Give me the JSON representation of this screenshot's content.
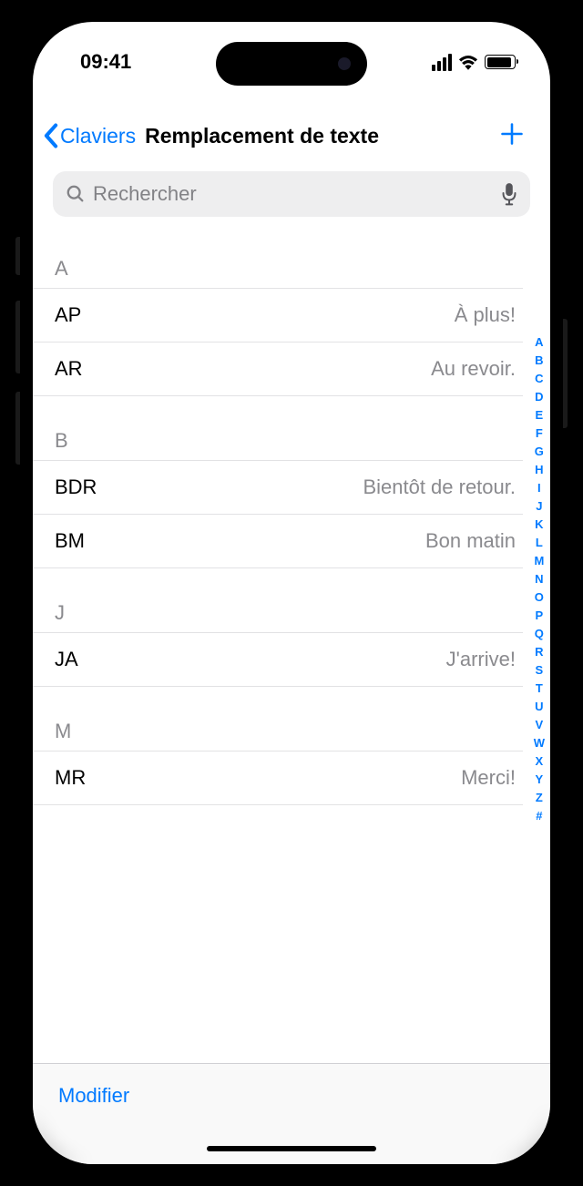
{
  "status": {
    "time": "09:41"
  },
  "nav": {
    "back": "Claviers",
    "title": "Remplacement de texte"
  },
  "search": {
    "placeholder": "Rechercher"
  },
  "sections": [
    {
      "letter": "A",
      "rows": [
        {
          "short": "AP",
          "phrase": "À plus!"
        },
        {
          "short": "AR",
          "phrase": "Au revoir."
        }
      ]
    },
    {
      "letter": "B",
      "rows": [
        {
          "short": "BDR",
          "phrase": "Bientôt de retour."
        },
        {
          "short": "BM",
          "phrase": "Bon matin"
        }
      ]
    },
    {
      "letter": "J",
      "rows": [
        {
          "short": "JA",
          "phrase": "J'arrive!"
        }
      ]
    },
    {
      "letter": "M",
      "rows": [
        {
          "short": "MR",
          "phrase": "Merci!"
        }
      ]
    }
  ],
  "index": [
    "A",
    "B",
    "C",
    "D",
    "E",
    "F",
    "G",
    "H",
    "I",
    "J",
    "K",
    "L",
    "M",
    "N",
    "O",
    "P",
    "Q",
    "R",
    "S",
    "T",
    "U",
    "V",
    "W",
    "X",
    "Y",
    "Z",
    "#"
  ],
  "toolbar": {
    "edit": "Modifier"
  }
}
